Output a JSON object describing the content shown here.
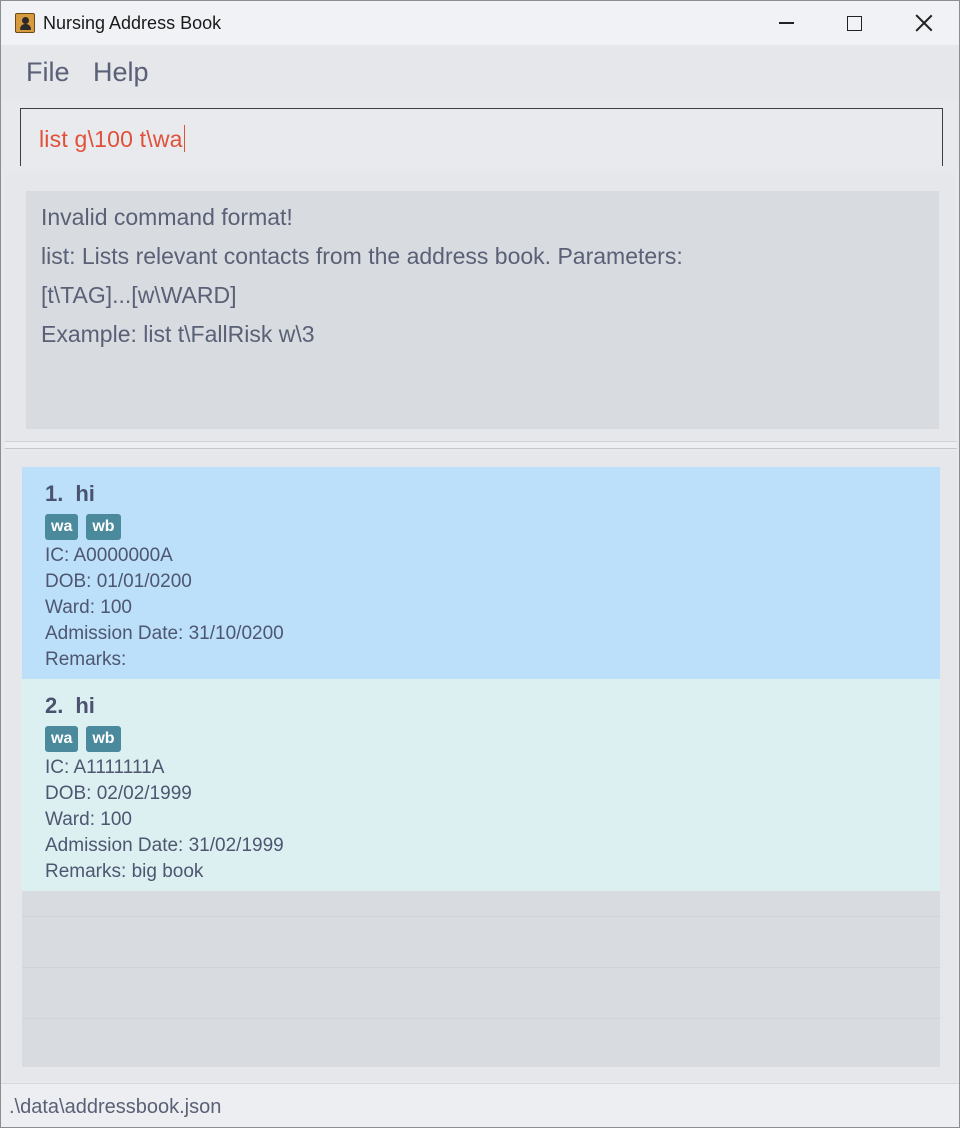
{
  "window": {
    "title": "Nursing Address Book"
  },
  "menu": {
    "items": [
      {
        "label": "File"
      },
      {
        "label": "Help"
      }
    ]
  },
  "command": {
    "value": "list g\\100 t\\wa"
  },
  "result": {
    "lines": [
      "Invalid command format!",
      "list: Lists relevant contacts from the address book. Parameters:",
      "[t\\TAG]...[w\\WARD]",
      "Example: list t\\FallRisk w\\3"
    ]
  },
  "persons": [
    {
      "index": "1.",
      "name": "hi",
      "tags": [
        "wa",
        "wb"
      ],
      "ic": "IC: A0000000A",
      "dob": "DOB: 01/01/0200",
      "ward": "Ward: 100",
      "admission": "Admission Date: 31/10/0200",
      "remarks": "Remarks:"
    },
    {
      "index": "2.",
      "name": "hi",
      "tags": [
        "wa",
        "wb"
      ],
      "ic": "IC: A1111111A",
      "dob": "DOB: 02/02/1999",
      "ward": "Ward: 100",
      "admission": "Admission Date: 31/02/1999",
      "remarks": "Remarks: big book"
    }
  ],
  "status": {
    "file_path": ".\\data\\addressbook.json"
  },
  "colors": {
    "selected_card": "#bce0fa",
    "card": "#dcf0f2",
    "tag": "#4a8a9c",
    "command_text": "#e0503a"
  }
}
